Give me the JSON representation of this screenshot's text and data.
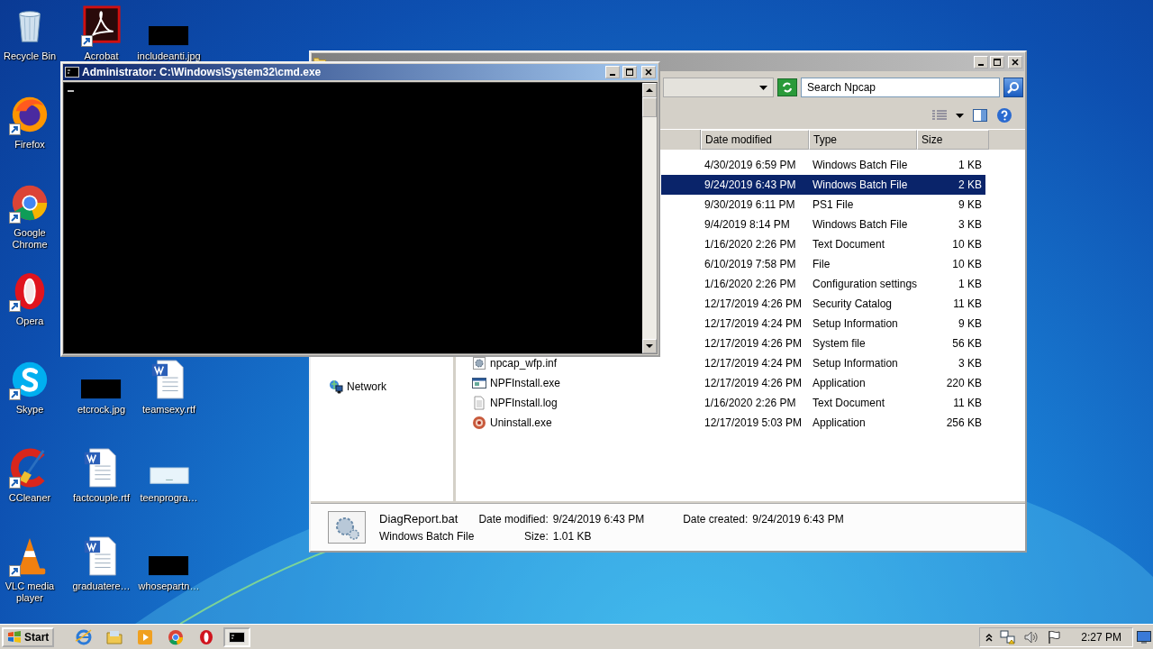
{
  "desktop": {
    "columns": [
      {
        "items": [
          {
            "label": "Recycle Bin",
            "kind": "recycle",
            "shortcut": false
          },
          {
            "label": "Firefox",
            "kind": "firefox",
            "shortcut": true
          },
          {
            "label": "Google Chrome",
            "kind": "chrome",
            "shortcut": true
          },
          {
            "label": "Opera",
            "kind": "opera",
            "shortcut": true
          },
          {
            "label": "Skype",
            "kind": "skype",
            "shortcut": true
          },
          {
            "label": "CCleaner",
            "kind": "ccleaner",
            "shortcut": true
          },
          {
            "label": "VLC media player",
            "kind": "vlc",
            "shortcut": true
          }
        ]
      },
      {
        "items": [
          {
            "label": "Acrobat",
            "kind": "acrobat",
            "shortcut": true
          },
          {
            "label": "etcrock.jpg",
            "kind": "redacted",
            "shortcut": false
          },
          {
            "label": "factcouple.rtf",
            "kind": "word",
            "shortcut": false
          },
          {
            "label": "graduatere…",
            "kind": "word",
            "shortcut": false
          }
        ]
      },
      {
        "items": [
          {
            "label": "includeanti.jpg",
            "kind": "redacted",
            "shortcut": false
          },
          {
            "label": "teamsexy.rtf",
            "kind": "word",
            "shortcut": false
          },
          {
            "label": "teenprogra…",
            "kind": "blank-image",
            "shortcut": false
          },
          {
            "label": "whosepartn…",
            "kind": "redacted",
            "shortcut": false
          }
        ]
      }
    ]
  },
  "cmd_window": {
    "title": "Administrator: C:\\Windows\\System32\\cmd.exe"
  },
  "explorer_window": {
    "search": {
      "placeholder": "Search Npcap"
    },
    "columns": [
      "Date modified",
      "Type",
      "Size"
    ],
    "navigation": [
      {
        "label": "Network"
      }
    ],
    "rows": [
      {
        "date": "4/30/2019 6:59 PM",
        "type": "Windows Batch File",
        "size": "1 KB",
        "selected": false
      },
      {
        "date": "9/24/2019 6:43 PM",
        "type": "Windows Batch File",
        "size": "2 KB",
        "selected": true
      },
      {
        "date": "9/30/2019 6:11 PM",
        "type": "PS1 File",
        "size": "9 KB",
        "selected": false
      },
      {
        "date": "9/4/2019 8:14 PM",
        "type": "Windows Batch File",
        "size": "3 KB",
        "selected": false
      },
      {
        "date": "1/16/2020 2:26 PM",
        "type": "Text Document",
        "size": "10 KB",
        "selected": false
      },
      {
        "date": "6/10/2019 7:58 PM",
        "type": "File",
        "size": "10 KB",
        "selected": false
      },
      {
        "date": "1/16/2020 2:26 PM",
        "type": "Configuration settings",
        "size": "1 KB",
        "selected": false
      },
      {
        "date": "12/17/2019 4:26 PM",
        "type": "Security Catalog",
        "size": "11 KB",
        "selected": false
      },
      {
        "date": "12/17/2019 4:24 PM",
        "type": "Setup Information",
        "size": "9 KB",
        "selected": false
      },
      {
        "date": "12/17/2019 4:26 PM",
        "type": "System file",
        "size": "56 KB",
        "selected": false
      },
      {
        "name": "npcap_wfp.inf",
        "kind": "settings",
        "date": "12/17/2019 4:24 PM",
        "type": "Setup Information",
        "size": "3 KB",
        "selected": false
      },
      {
        "name": "NPFInstall.exe",
        "kind": "application",
        "date": "12/17/2019 4:26 PM",
        "type": "Application",
        "size": "220 KB",
        "selected": false
      },
      {
        "name": "NPFInstall.log",
        "kind": "text",
        "date": "1/16/2020 2:26 PM",
        "type": "Text Document",
        "size": "11 KB",
        "selected": false
      },
      {
        "name": "Uninstall.exe",
        "kind": "uninstaller",
        "date": "12/17/2019 5:03 PM",
        "type": "Application",
        "size": "256 KB",
        "selected": false
      }
    ],
    "details": {
      "name": "DiagReport.bat",
      "type": "Windows Batch File",
      "fields": [
        {
          "label": "Date modified:",
          "value": "9/24/2019 6:43 PM"
        },
        {
          "label": "Size:",
          "value": "1.01 KB"
        },
        {
          "label": "Date created:",
          "value": "9/24/2019 6:43 PM"
        }
      ]
    }
  },
  "taskbar": {
    "start": "Start",
    "apps": [
      {
        "kind": "browser",
        "active": false
      },
      {
        "kind": "folder",
        "active": false
      },
      {
        "kind": "media",
        "active": false
      },
      {
        "kind": "chrome",
        "active": false
      },
      {
        "kind": "opera",
        "active": false
      },
      {
        "kind": "console",
        "active": true
      }
    ],
    "clock": "2:27 PM"
  }
}
